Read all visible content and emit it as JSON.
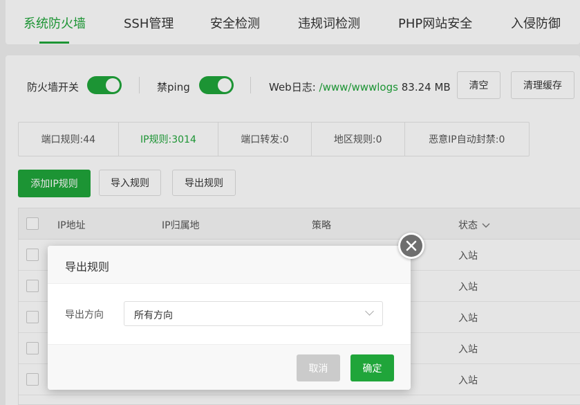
{
  "tabs": [
    {
      "label": "系统防火墙",
      "active": true
    },
    {
      "label": "SSH管理",
      "active": false
    },
    {
      "label": "安全检测",
      "active": false
    },
    {
      "label": "违规词检测",
      "active": false
    },
    {
      "label": "PHP网站安全",
      "active": false
    },
    {
      "label": "入侵防御",
      "active": false
    }
  ],
  "controls": {
    "firewall_label": "防火墙开关",
    "ping_label": "禁ping",
    "weblog_label": "Web日志:",
    "weblog_path": "/www/wwwlogs",
    "weblog_size": "83.24 MB",
    "clear_button": "清空",
    "clear_cache_button": "清理缓存"
  },
  "stats": [
    {
      "label": "端口规则:44",
      "active": false
    },
    {
      "label": "IP规则:3014",
      "active": true
    },
    {
      "label": "端口转发:0",
      "active": false
    },
    {
      "label": "地区规则:0",
      "active": false
    },
    {
      "label": "恶意IP自动封禁:0",
      "active": false
    }
  ],
  "actions": {
    "add_ip_rule": "添加IP规则",
    "import_rules": "导入规则",
    "export_rules": "导出规则"
  },
  "table": {
    "headers": {
      "ip": "IP地址",
      "location": "IP归属地",
      "policy": "策略",
      "direction": "状态"
    },
    "rows": [
      {
        "direction": "入站"
      },
      {
        "direction": "入站"
      },
      {
        "direction": "入站"
      },
      {
        "direction": "入站"
      },
      {
        "direction": "入站"
      }
    ]
  },
  "modal": {
    "title": "导出规则",
    "field_label": "导出方向",
    "select_value": "所有方向",
    "cancel_label": "取消",
    "ok_label": "确定"
  },
  "colors": {
    "accent": "#20a53a",
    "cancel": "#cbcbcb"
  }
}
